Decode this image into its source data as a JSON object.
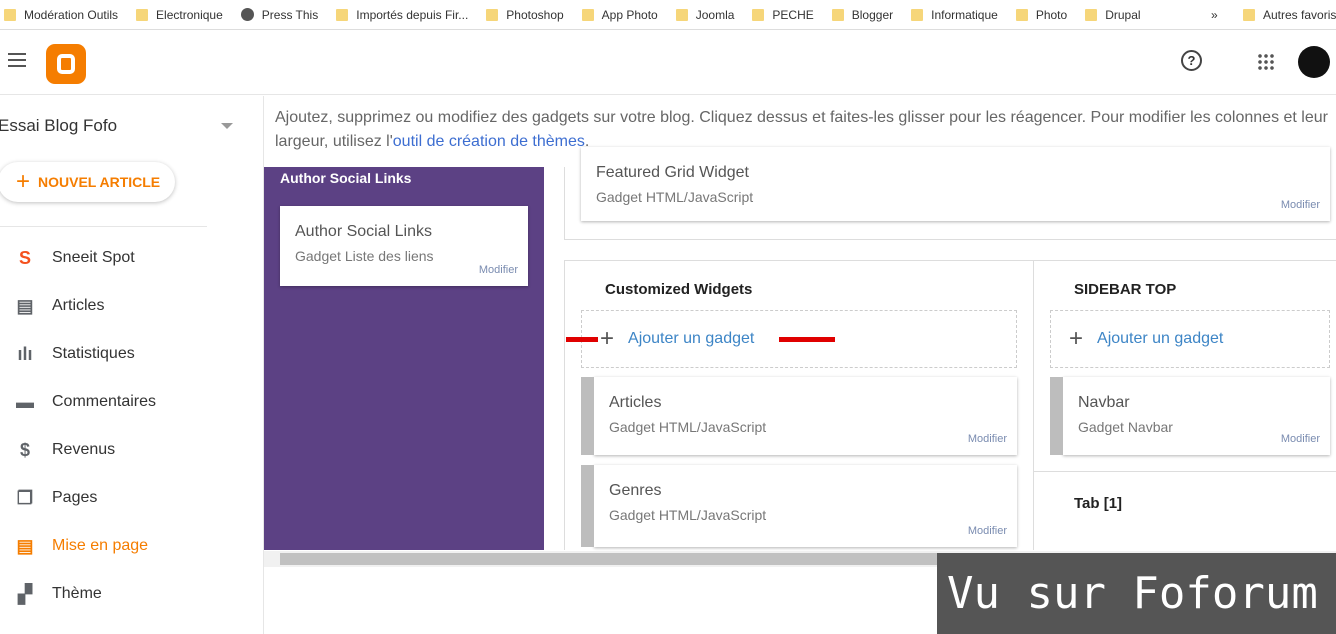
{
  "bookmarks": [
    "Modération Outils",
    "Electronique",
    "Press This",
    "Importés depuis Fir...",
    "Photoshop",
    "App Photo",
    "Joomla",
    "PECHE",
    "Blogger",
    "Informatique",
    "Photo",
    "Drupal"
  ],
  "bookmarks_more": "»",
  "bookmarks_other": "Autres favoris",
  "header": {
    "help": "?",
    "apps": "⋮⋮⋮"
  },
  "sidebar": {
    "blog_name": "Essai Blog Fofo",
    "new_post": "NOUVEL ARTICLE",
    "items": [
      {
        "label": "Sneeit Spot",
        "icon": "sneeit-icon"
      },
      {
        "label": "Articles",
        "icon": "posts-icon"
      },
      {
        "label": "Statistiques",
        "icon": "stats-icon"
      },
      {
        "label": "Commentaires",
        "icon": "comment-icon"
      },
      {
        "label": "Revenus",
        "icon": "dollar-icon"
      },
      {
        "label": "Pages",
        "icon": "pages-icon"
      },
      {
        "label": "Mise en page",
        "icon": "layout-icon"
      },
      {
        "label": "Thème",
        "icon": "theme-icon"
      }
    ]
  },
  "intro": {
    "text": "Ajoutez, supprimez ou modifiez des gadgets sur votre blog. Cliquez dessus et faites-les glisser pour les réagencer. Pour modifier les colonnes et leur largeur, utilisez l'",
    "link": "outil de création de thèmes",
    "end": "."
  },
  "author": {
    "title": "Author Social Links",
    "card_title": "Author Social Links",
    "card_sub": "Gadget Liste des liens",
    "modify": "Modifier"
  },
  "featured": {
    "title": "Featured Grid Widget",
    "sub": "Gadget HTML/JavaScript",
    "modify": "Modifier"
  },
  "custom": {
    "title": "Customized Widgets",
    "add": "Ajouter un gadget",
    "cards": [
      {
        "title": "Articles",
        "sub": "Gadget HTML/JavaScript",
        "modify": "Modifier"
      },
      {
        "title": "Genres",
        "sub": "Gadget HTML/JavaScript",
        "modify": "Modifier"
      }
    ]
  },
  "sidebar_top": {
    "title": "SIDEBAR TOP",
    "add": "Ajouter un gadget",
    "card": {
      "title": "Navbar",
      "sub": "Gadget Navbar",
      "modify": "Modifier"
    }
  },
  "tab": {
    "title": "Tab [1]"
  },
  "watermark": "Vu sur Foforum",
  "colors": {
    "accent": "#f57d00",
    "purple": "#5c4184",
    "link": "#3d85c6",
    "marker": "#e00000"
  }
}
